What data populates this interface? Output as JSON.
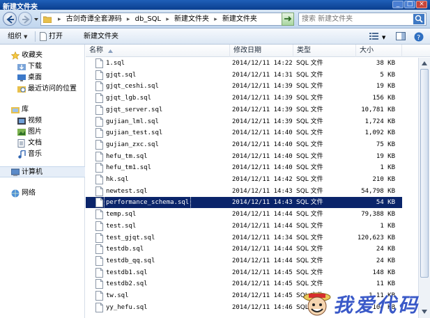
{
  "window": {
    "title": "新建文件夹"
  },
  "address": {
    "crumbs": [
      "古剑奇谭全套源码",
      "db_SQL",
      "新建文件夹",
      "新建文件夹"
    ],
    "separator": "▸"
  },
  "search": {
    "placeholder": "搜索 新建文件夹"
  },
  "toolbar": {
    "organize_label": "组织",
    "open_label": "打开",
    "new_folder_label": "新建文件夹"
  },
  "sidebar": {
    "favorites": {
      "label": "收藏夹",
      "items": [
        "下载",
        "桌面",
        "最近访问的位置"
      ]
    },
    "libraries": {
      "label": "库",
      "items": [
        "视频",
        "图片",
        "文档",
        "音乐"
      ]
    },
    "computer": "计算机",
    "network": "网络"
  },
  "list": {
    "columns": {
      "name": "名称",
      "date": "修改日期",
      "type": "类型",
      "size": "大小"
    },
    "selected_index": 10,
    "files": [
      {
        "name": "1.sql",
        "date": "2014/12/11 14:22",
        "type": "SQL 文件",
        "size": "38 KB"
      },
      {
        "name": "gjqt.sql",
        "date": "2014/12/11 14:31",
        "type": "SQL 文件",
        "size": "5 KB"
      },
      {
        "name": "gjqt_ceshi.sql",
        "date": "2014/12/11 14:39",
        "type": "SQL 文件",
        "size": "19 KB"
      },
      {
        "name": "gjqt_lgb.sql",
        "date": "2014/12/11 14:39",
        "type": "SQL 文件",
        "size": "156 KB"
      },
      {
        "name": "gjqt_server.sql",
        "date": "2014/12/11 14:39",
        "type": "SQL 文件",
        "size": "10,781 KB"
      },
      {
        "name": "gujian_lml.sql",
        "date": "2014/12/11 14:39",
        "type": "SQL 文件",
        "size": "1,724 KB"
      },
      {
        "name": "gujian_test.sql",
        "date": "2014/12/11 14:40",
        "type": "SQL 文件",
        "size": "1,092 KB"
      },
      {
        "name": "gujian_zxc.sql",
        "date": "2014/12/11 14:40",
        "type": "SQL 文件",
        "size": "75 KB"
      },
      {
        "name": "hefu_tm.sql",
        "date": "2014/12/11 14:40",
        "type": "SQL 文件",
        "size": "19 KB"
      },
      {
        "name": "hefu_tm1.sql",
        "date": "2014/12/11 14:40",
        "type": "SQL 文件",
        "size": "1 KB"
      },
      {
        "name": "hk.sql",
        "date": "2014/12/11 14:42",
        "type": "SQL 文件",
        "size": "210 KB"
      },
      {
        "name": "newtest.sql",
        "date": "2014/12/11 14:43",
        "type": "SQL 文件",
        "size": "54,798 KB"
      },
      {
        "name": "performance_schema.sql",
        "date": "2014/12/11 14:43",
        "type": "SQL 文件",
        "size": "54 KB"
      },
      {
        "name": "temp.sql",
        "date": "2014/12/11 14:44",
        "type": "SQL 文件",
        "size": "79,388 KB"
      },
      {
        "name": "test.sql",
        "date": "2014/12/11 14:44",
        "type": "SQL 文件",
        "size": "1 KB"
      },
      {
        "name": "test_gjqt.sql",
        "date": "2014/12/11 14:34",
        "type": "SQL 文件",
        "size": "120,623 KB"
      },
      {
        "name": "testdb.sql",
        "date": "2014/12/11 14:44",
        "type": "SQL 文件",
        "size": "24 KB"
      },
      {
        "name": "testdb_qq.sql",
        "date": "2014/12/11 14:44",
        "type": "SQL 文件",
        "size": "24 KB"
      },
      {
        "name": "testdb1.sql",
        "date": "2014/12/11 14:45",
        "type": "SQL 文件",
        "size": "148 KB"
      },
      {
        "name": "testdb2.sql",
        "date": "2014/12/11 14:45",
        "type": "SQL 文件",
        "size": "11 KB"
      },
      {
        "name": "tw.sql",
        "date": "2014/12/11 14:45",
        "type": "SQL 文件",
        "size": "1,11 KB"
      },
      {
        "name": "yy_hefu.sql",
        "date": "2014/12/11 14:46",
        "type": "SQL 文件",
        "size": "104 KB"
      }
    ]
  },
  "watermark": {
    "text": "我爱代码"
  },
  "colors": {
    "title_bar": "#1f5fb8",
    "selection": "#0a246a",
    "watermark": "#3a59c8"
  }
}
